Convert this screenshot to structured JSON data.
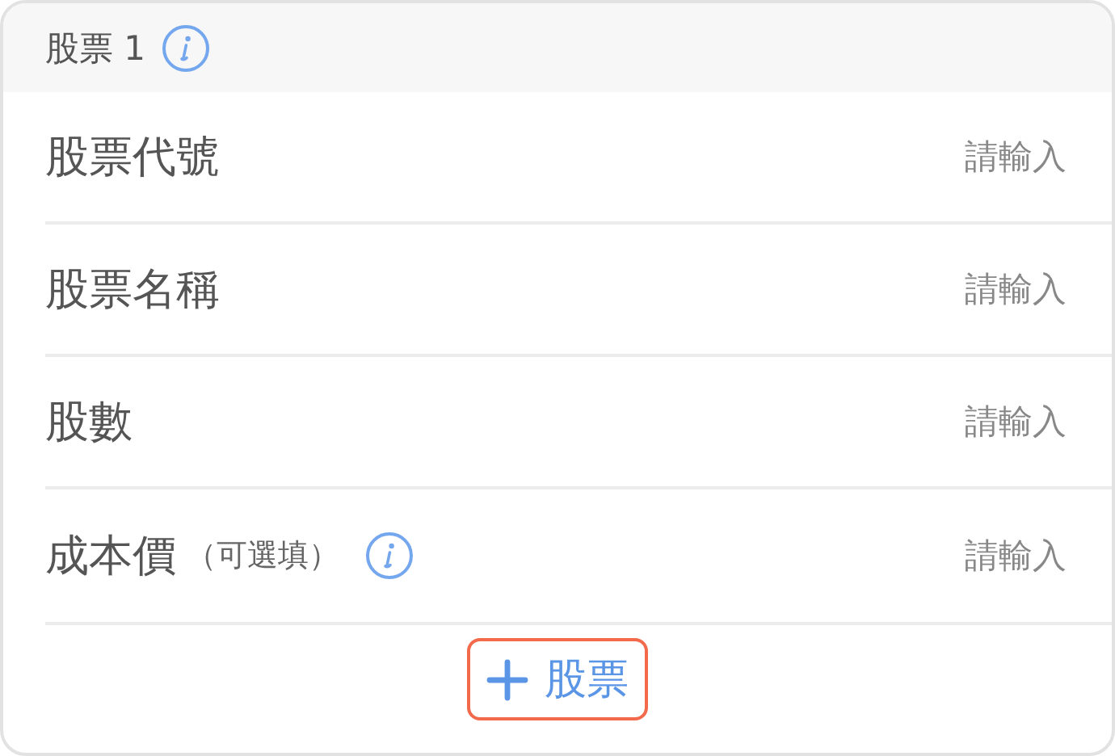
{
  "section": {
    "title": "股票 1",
    "info": true
  },
  "fields": [
    {
      "label": "股票代號",
      "placeholder": "請輸入"
    },
    {
      "label": "股票名稱",
      "placeholder": "請輸入"
    },
    {
      "label": "股數",
      "placeholder": "請輸入"
    },
    {
      "label": "成本價",
      "note": "（可選填）",
      "info": true,
      "placeholder": "請輸入"
    }
  ],
  "add_button": {
    "label": "股票",
    "focused": true
  }
}
